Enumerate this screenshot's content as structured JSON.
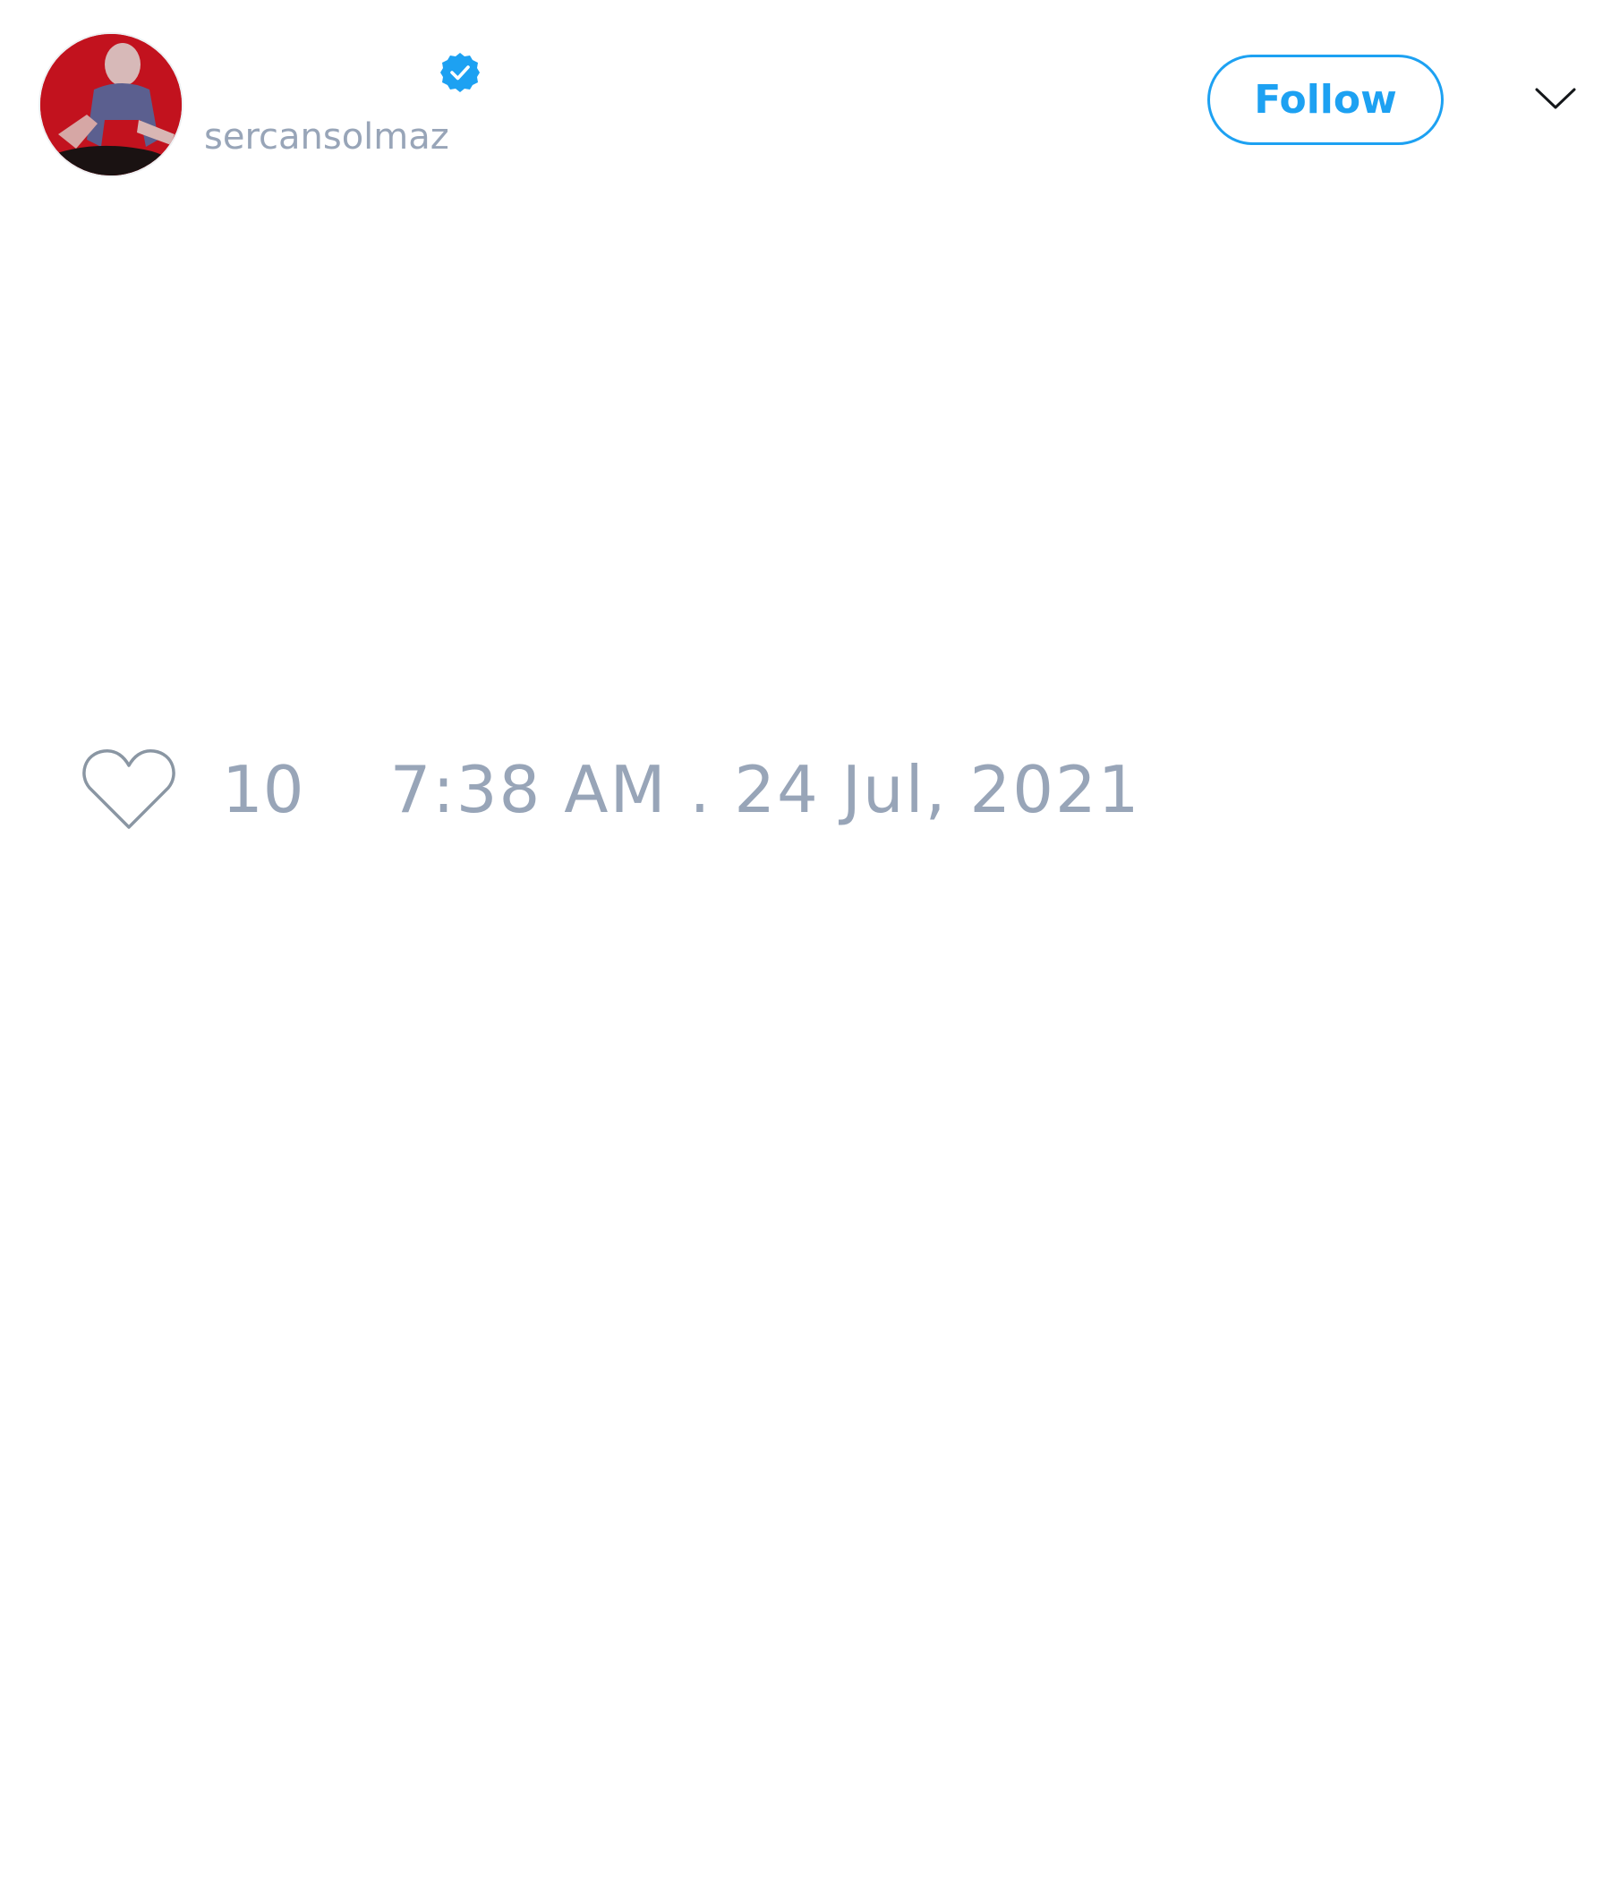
{
  "tweet": {
    "author": {
      "display_name": "",
      "handle": "sercansolmaz",
      "verified_icon": "verified-badge-icon",
      "avatar": "avatar"
    },
    "header": {
      "follow_label": "Follow",
      "menu_icon": "chevron-down-icon"
    },
    "stats": {
      "like_icon": "heart-icon",
      "like_count": "10",
      "timestamp": "7:38 AM . 24 Jul, 2021"
    }
  },
  "colors": {
    "accent": "#1da1f2",
    "muted_text": "#98a5b8",
    "avatar_background": "#c2121e"
  }
}
